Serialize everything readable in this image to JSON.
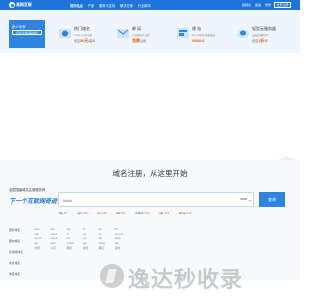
{
  "brand": {
    "logo_text": "易网互联"
  },
  "nav": {
    "items": [
      "首页站点",
      "产品",
      "服务与支持",
      "解决方案",
      "行业新闻"
    ]
  },
  "top_right": {
    "items": [
      "控制台",
      "备案",
      "登录"
    ],
    "register": "免费注册"
  },
  "login_box": {
    "greeting": "新人专享",
    "action": "登录/注册领取福利"
  },
  "promos": [
    {
      "title": "热门域名",
      "sub": ".com/.cn 新注册",
      "price_prefix": "低至",
      "price": "30元",
      "price_suffix": "/首年"
    },
    {
      "title": "邮  局",
      "sub": "企业邮局专业版",
      "price_prefix": "",
      "price": "免费",
      "price_suffix": "试用"
    },
    {
      "title": "建  站",
      "sub": "PC+手机站 模板建站",
      "price_prefix": "",
      "price": "¥588",
      "price_suffix": "/年"
    },
    {
      "title": "轻型云服务器",
      "sub": "云服务器新用户",
      "price_prefix": "低至",
      "price": "1折",
      "price_suffix": "/年"
    }
  ],
  "search": {
    "title": "域名注册，从这里开始",
    "slogan_small": "全国顶级域名注册服务商",
    "slogan_big": "下一个互联网奇迹",
    "placeholder": "Baidu",
    "tld": ".com",
    "button": "查询"
  },
  "suffixes": [
    {
      "suffix": ".top",
      "price": "¥7"
    },
    {
      "suffix": ".xyz",
      "price": "¥15"
    },
    {
      "suffix": ".cc",
      "price": "¥15"
    },
    {
      "suffix": ".ltd",
      "price": "¥27"
    },
    {
      "suffix": ".online",
      "price": "¥15"
    },
    {
      "suffix": ".vip",
      "price": "¥15"
    },
    {
      "suffix": ".shop",
      "price": "¥15"
    }
  ],
  "categories": [
    "国际域名",
    "国内域名",
    "新顶级域名",
    "中文域名",
    "地区域名"
  ],
  "tld_grid": [
    ".com",
    ".net",
    ".org",
    ".cc",
    ".co",
    ".biz",
    ".info",
    ".name",
    ".tv",
    ".me",
    ".cn",
    ".com.cn",
    ".net.cn",
    ".org.cn",
    ".top",
    ".xyz",
    ".vip",
    ".shop",
    ".ltd",
    ".club",
    ".online",
    ".site",
    ".wang",
    ".link",
    ".中国",
    ".公司",
    ".网络",
    ".在线",
    ".网址",
    ".商城"
  ],
  "watermark": {
    "text": "逸达秒收录"
  },
  "colors": {
    "primary": "#1f74d9",
    "accent": "#ff5a00",
    "hero_bg": "#eef5fd"
  },
  "icons": {
    "float_email": "envelope-icon"
  }
}
